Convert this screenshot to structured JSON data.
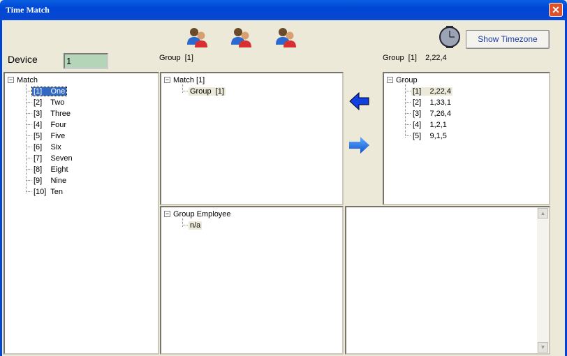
{
  "window": {
    "title": "Time Match",
    "close": "✕"
  },
  "device": {
    "label": "Device",
    "value": "1"
  },
  "middle": {
    "header": "Group  [1]",
    "top_tree": {
      "root": "Match  [1]",
      "child": "Group  [1]"
    },
    "bottom_tree": {
      "root": "Group Employee",
      "child": "n/a"
    }
  },
  "right": {
    "header": "Group  [1]    2,22,4",
    "tree": {
      "root": "Group",
      "items": [
        "[1]    2,22,4",
        "[2]    1,33,1",
        "[3]    7,26,4",
        "[4]    1,2,1",
        "[5]    9,1,5"
      ]
    }
  },
  "left_tree": {
    "root": "Match",
    "items": [
      "[1]    One",
      "[2]    Two",
      "[3]    Three",
      "[4]    Four",
      "[5]    Five",
      "[6]    Six",
      "[7]    Seven",
      "[8]    Eight",
      "[9]    Nine",
      "[10]  Ten"
    ]
  },
  "toolbar": {
    "show_timezone": "Show Timezone",
    "icons": [
      "users-icon",
      "users-icon",
      "users-icon",
      "clock-icon"
    ]
  },
  "arrows": {
    "left": "arrow-left-icon",
    "right": "arrow-right-icon"
  },
  "colors": {
    "titlebar": "#0046d5",
    "selection": "#316ac5",
    "device_field": "#b5d5b9"
  }
}
